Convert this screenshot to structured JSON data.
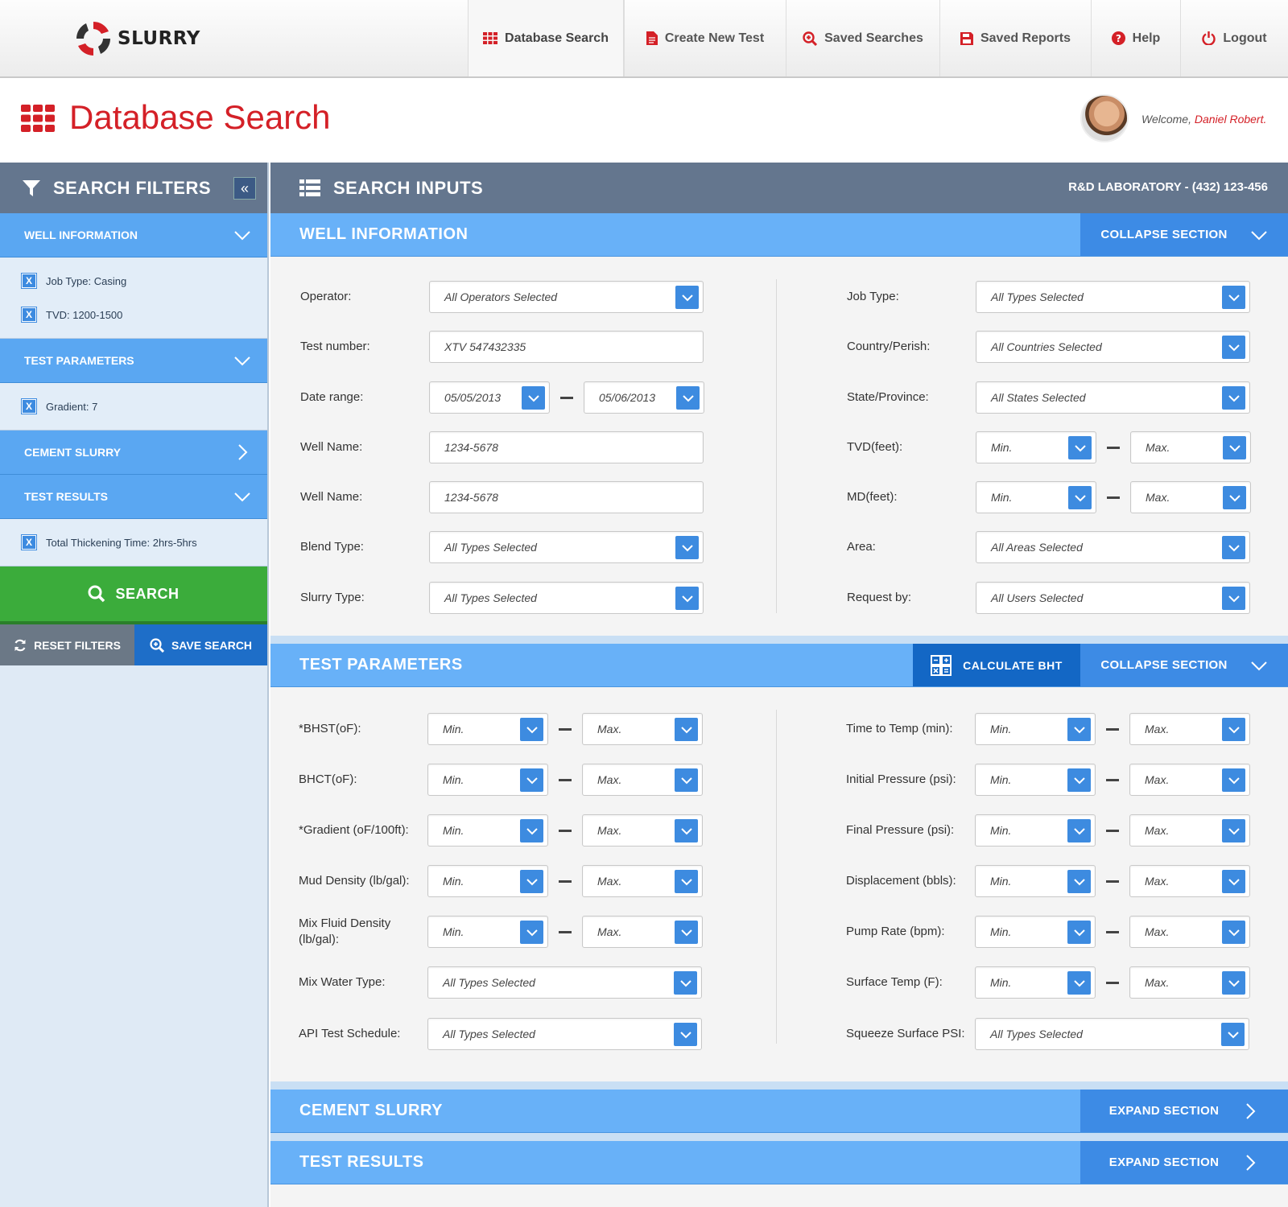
{
  "brand": {
    "name": "SLURRY"
  },
  "nav": {
    "items": [
      {
        "label": "Database Search",
        "icon": "grid-icon"
      },
      {
        "label": "Create New Test",
        "icon": "document-icon"
      },
      {
        "label": "Saved Searches",
        "icon": "search-plus-icon"
      },
      {
        "label": "Saved Reports",
        "icon": "floppy-disk-icon"
      },
      {
        "label": "Help",
        "icon": "question-circle-icon"
      },
      {
        "label": "Logout",
        "icon": "power-icon"
      }
    ]
  },
  "header": {
    "title": "Database Search",
    "welcome_prefix": "Welcome, ",
    "user_name": "Daniel Robert."
  },
  "filters": {
    "title": "SEARCH FILTERS",
    "sections": [
      {
        "label": "WELL INFORMATION",
        "items": [
          "Job Type: Casing",
          "TVD: 1200-1500"
        ]
      },
      {
        "label": "TEST PARAMETERS",
        "items": [
          "Gradient: 7"
        ]
      },
      {
        "label": "CEMENT SLURRY",
        "items": []
      },
      {
        "label": "TEST RESULTS",
        "items": [
          "Total Thickening Time: 2hrs-5hrs"
        ]
      }
    ],
    "search_label": "SEARCH",
    "reset_label": "RESET FILTERS",
    "save_label": "SAVE SEARCH",
    "remove_glyph": "X"
  },
  "inputs": {
    "title": "SEARCH INPUTS",
    "lab": "R&D LABORATORY - (432) 123-456",
    "collapse_label": "COLLAPSE SECTION",
    "expand_label": "EXPAND SECTION",
    "calc_label": "CALCULATE BHT",
    "well": {
      "title": "WELL INFORMATION",
      "left": [
        {
          "label": "Operator:",
          "type": "select",
          "value": "All Operators Selected"
        },
        {
          "label": "Test number:",
          "type": "text",
          "value": "XTV 547432335"
        },
        {
          "label": "Date range:",
          "type": "range",
          "min": "05/05/2013",
          "max": "05/06/2013"
        },
        {
          "label": "Well Name:",
          "type": "text",
          "value": "1234-5678"
        },
        {
          "label": "Well Name:",
          "type": "text",
          "value": "1234-5678"
        },
        {
          "label": "Blend Type:",
          "type": "select",
          "value": "All Types Selected"
        },
        {
          "label": "Slurry Type:",
          "type": "select",
          "value": "All Types Selected"
        }
      ],
      "right": [
        {
          "label": "Job Type:",
          "type": "select",
          "value": "All Types Selected"
        },
        {
          "label": "Country/Perish:",
          "type": "select",
          "value": "All Countries Selected"
        },
        {
          "label": "State/Province:",
          "type": "select",
          "value": "All States Selected"
        },
        {
          "label": "TVD(feet):",
          "type": "range",
          "min": "Min.",
          "max": "Max."
        },
        {
          "label": "MD(feet):",
          "type": "range",
          "min": "Min.",
          "max": "Max."
        },
        {
          "label": "Area:",
          "type": "select",
          "value": "All Areas Selected"
        },
        {
          "label": "Request by:",
          "type": "select",
          "value": "All Users Selected"
        }
      ]
    },
    "test": {
      "title": "TEST PARAMETERS",
      "left": [
        {
          "label": "*BHST(oF):",
          "type": "range",
          "min": "Min.",
          "max": "Max."
        },
        {
          "label": "BHCT(oF):",
          "type": "range",
          "min": "Min.",
          "max": "Max."
        },
        {
          "label": "*Gradient (oF/100ft):",
          "type": "range",
          "min": "Min.",
          "max": "Max."
        },
        {
          "label": "Mud Density (lb/gal):",
          "type": "range",
          "min": "Min.",
          "max": "Max."
        },
        {
          "label": "Mix Fluid Density (lb/gal):",
          "type": "range",
          "min": "Min.",
          "max": "Max."
        },
        {
          "label": "Mix Water Type:",
          "type": "select",
          "value": "All Types Selected"
        },
        {
          "label": "API Test Schedule:",
          "type": "select",
          "value": "All Types Selected"
        }
      ],
      "right": [
        {
          "label": "Time to Temp (min):",
          "type": "range",
          "min": "Min.",
          "max": "Max."
        },
        {
          "label": "Initial Pressure (psi):",
          "type": "range",
          "min": "Min.",
          "max": "Max."
        },
        {
          "label": "Final Pressure (psi):",
          "type": "range",
          "min": "Min.",
          "max": "Max."
        },
        {
          "label": "Displacement (bbls):",
          "type": "range",
          "min": "Min.",
          "max": "Max."
        },
        {
          "label": "Pump Rate (bpm):",
          "type": "range",
          "min": "Min.",
          "max": "Max."
        },
        {
          "label": "Surface Temp (F):",
          "type": "range",
          "min": "Min.",
          "max": "Max."
        },
        {
          "label": "Squeeze Surface PSI:",
          "type": "select",
          "value": "All Types Selected"
        }
      ]
    },
    "cement": {
      "title": "CEMENT SLURRY"
    },
    "results": {
      "title": "TEST RESULTS"
    }
  },
  "colors": {
    "brand_red": "#d42027",
    "header_slate": "#64768e",
    "section_blue": "#68b1f8",
    "button_blue": "#3d8be5",
    "search_green": "#3bac3b"
  }
}
